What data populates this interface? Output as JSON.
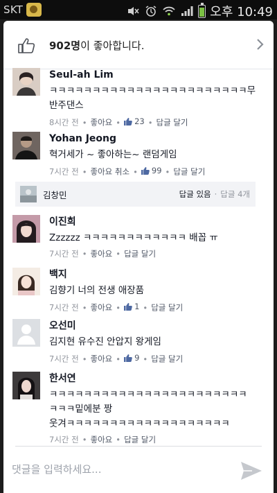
{
  "status_bar": {
    "carrier": "SKT",
    "time": "오후 10:49"
  },
  "likes": {
    "count": "902명",
    "suffix": "이 좋아합니다."
  },
  "comments": [
    {
      "name": "Seul-ah Lim",
      "text": "ㅋㅋㅋㅋㅋㅋㅋㅋㅋㅋㅋㅋㅋㅋㅋㅋㅋㅋㅋㅋㅋㅋㅋ무반주댄스",
      "time": "8시간 전",
      "like_label": "좋아요",
      "like_count": "23",
      "reply_label": "답글 달기"
    },
    {
      "name": "Yohan Jeong",
      "text": "혁거세가 ~ 좋아하는~ 랜덤게임",
      "time": "7시간 전",
      "like_label": "좋아요 취소",
      "like_count": "99",
      "reply_label": "답글 달기"
    },
    {
      "name": "이진희",
      "text": "Zzzzzz ㅋㅋㅋㅋㅋㅋㅋㅋㅋㅋㅋㅋ 배꼽 ㅠ",
      "time": "7시간 전",
      "like_label": "좋아요",
      "reply_label": "답글 달기"
    },
    {
      "name": "백지",
      "text": "김향기 너의 전생 애장품",
      "time": "7시간 전",
      "like_label": "좋아요",
      "like_count": "1",
      "reply_label": "답글 달기"
    },
    {
      "name": "오선미",
      "text": "김지현 유수진  안압지 왕게임",
      "time": "7시간 전",
      "like_label": "좋아요",
      "like_count": "9",
      "reply_label": "답글 달기"
    },
    {
      "name": "한서연",
      "text_lines": [
        "ㅋㅋㅋㅋㅋㅋㅋㅋㅋㅋㅋㅋㅋㅋㅋㅋㅋㅋㅋㅋㅋㅋㅋ",
        "ㅋㅋㅋ밑에분 짱",
        "웃겨ㅋㅋㅋㅋㅋㅋㅋㅋㅋㅋㅋㅋㅋㅋㅋㅋㅋㅋㅋ"
      ],
      "time": "7시간 전",
      "like_label": "좋아요",
      "reply_label": "답글 달기"
    }
  ],
  "reply_thread": {
    "name": "김창민",
    "status": "답글 있음",
    "count": "답글 4개"
  },
  "composer": {
    "placeholder": "댓글을 입력하세요..."
  },
  "icons": {
    "like_button": "thumbs-up-outline-icon",
    "chevron": "chevron-right-icon",
    "like_count": "thumbs-up-filled-icon",
    "send": "send-icon"
  },
  "colors": {
    "accent": "#4e69a2",
    "meta": "#90949c",
    "placeholder_avatar": "#d3d6db"
  }
}
